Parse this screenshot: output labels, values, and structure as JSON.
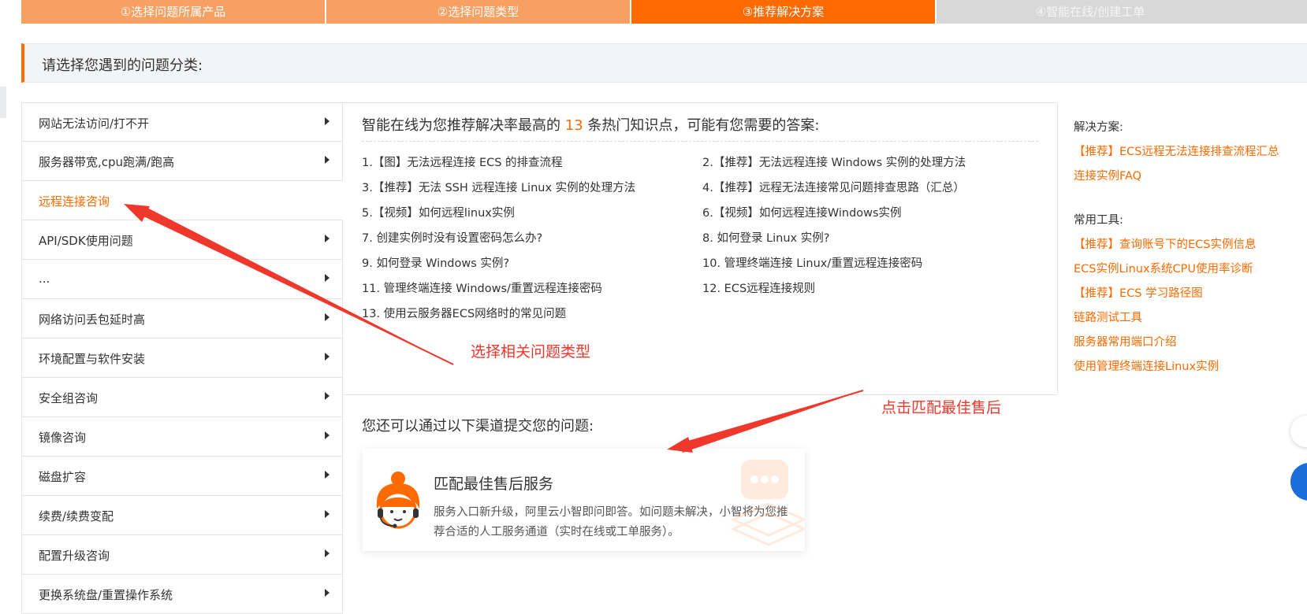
{
  "steps": [
    {
      "label": "①选择问题所属产品",
      "state": "done"
    },
    {
      "label": "②选择问题类型",
      "state": "done"
    },
    {
      "label": "③推荐解决方案",
      "state": "active"
    },
    {
      "label": "④智能在线/创建工单",
      "state": "todo"
    }
  ],
  "category_header": "请选择您遇到的问题分类:",
  "menu": {
    "items": [
      {
        "label": "网站无法访问/打不开",
        "selected": false
      },
      {
        "label": "服务器带宽,cpu跑满/跑高",
        "selected": false
      },
      {
        "label": "远程连接咨询",
        "selected": true
      },
      {
        "label": "API/SDK使用问题",
        "selected": false
      },
      {
        "label": "...",
        "selected": false
      },
      {
        "label": "网络访问丢包延时高",
        "selected": false
      },
      {
        "label": "环境配置与软件安装",
        "selected": false
      },
      {
        "label": "安全组咨询",
        "selected": false
      },
      {
        "label": "镜像咨询",
        "selected": false
      },
      {
        "label": "磁盘扩容",
        "selected": false
      },
      {
        "label": "续费/续费变配",
        "selected": false
      },
      {
        "label": "配置升级咨询",
        "selected": false
      },
      {
        "label": "更换系统盘/重置操作系统",
        "selected": false
      }
    ]
  },
  "recommend": {
    "title_prefix": "智能在线为您推荐解决率最高的 ",
    "count": "13",
    "title_suffix": " 条热门知识点，可能有您需要的答案:",
    "items": [
      "1.【图】无法远程连接 ECS 的排查流程",
      "2.【推荐】无法远程连接 Windows 实例的处理方法",
      "3.【推荐】无法 SSH 远程连接 Linux 实例的处理方法",
      "4.【推荐】远程无法连接常见问题排查思路（汇总）",
      "5.【视频】如何远程linux实例",
      "6.【视频】如何远程连接Windows实例",
      "7. 创建实例时没有设置密码怎么办?",
      "8. 如何登录 Linux 实例?",
      "9. 如何登录 Windows 实例?",
      "10. 管理终端连接 Linux/重置远程连接密码",
      "11. 管理终端连接 Windows/重置远程连接密码",
      "12. ECS远程连接规则",
      "13. 使用云服务器ECS网络时的常见问题"
    ]
  },
  "aside": {
    "solutions_title": "解决方案:",
    "solutions": [
      "【推荐】ECS远程无法连接排查流程汇总",
      "连接实例FAQ"
    ],
    "tools_title": "常用工具:",
    "tools": [
      "【推荐】查询账号下的ECS实例信息",
      "ECS实例Linux系统CPU使用率诊断",
      "【推荐】ECS 学习路径图",
      "链路测试工具",
      "服务器常用端口介绍",
      "使用管理终端连接Linux实例"
    ]
  },
  "channels": {
    "title": "您还可以通过以下渠道提交您的问题:",
    "card": {
      "title": "匹配最佳售后服务",
      "desc": "服务入口新升级，阿里云小智即问即答。如问题未解决，小智将为您推荐合适的人工服务通道（实时在线或工单服务）。"
    }
  },
  "annotations": {
    "select_type": "选择相关问题类型",
    "click_match": "点击匹配最佳售后"
  },
  "colors": {
    "accent": "#ff6a00",
    "step_done": "#f7a061",
    "step_todo": "#d8d8d8",
    "annotation": "#f0372c"
  }
}
